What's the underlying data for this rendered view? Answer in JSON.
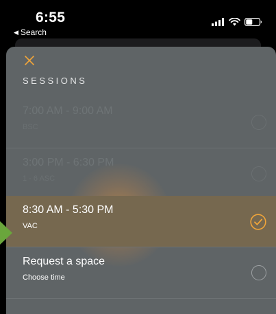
{
  "status_bar": {
    "time": "6:55",
    "back_label": "Search",
    "back_icon": "back-caret",
    "icons": [
      "signal-icon",
      "wifi-icon",
      "battery-icon"
    ]
  },
  "modal": {
    "close_icon": "close-icon",
    "heading": "SESSIONS",
    "accent_color": "#f0a53a",
    "sessions": [
      {
        "time": "7:00 AM - 9:00 AM",
        "code": "BSC",
        "state": "unavailable"
      },
      {
        "time": "3:00 PM - 6:30 PM",
        "code": "1 - 6 ASC",
        "state": "unavailable"
      },
      {
        "time": "8:30 AM - 5:30 PM",
        "code": "VAC",
        "state": "selected"
      }
    ],
    "request": {
      "title": "Request a space",
      "subtitle": "Choose time",
      "state": "unselected"
    }
  },
  "pointer": {
    "icon": "arrow-icon",
    "color": "#6aa63c"
  }
}
